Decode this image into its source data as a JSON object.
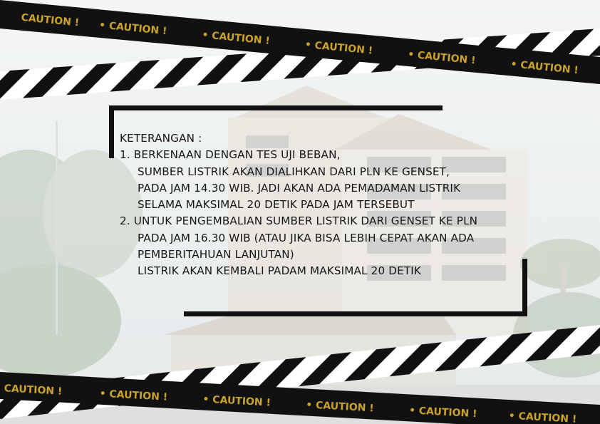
{
  "tape": {
    "label": "CAUTION !",
    "colors": {
      "tape": "#111111",
      "text": "#c9a227",
      "stripe": "#ffffff"
    }
  },
  "notice": {
    "heading": "KETERANGAN :",
    "item1": {
      "number": "1.",
      "line1": "BERKENAAN DENGAN TES UJI BEBAN,",
      "line2": "SUMBER LISTRIK AKAN DIALIHKAN DARI PLN KE GENSET,",
      "line3": "PADA JAM 14.30 WIB. JADI AKAN ADA PEMADAMAN LISTRIK",
      "line4": "SELAMA MAKSIMAL 20 DETIK PADA JAM TERSEBUT"
    },
    "item2": {
      "number": "2.",
      "line1": "UNTUK PENGEMBALIAN SUMBER LISTRIK DARI GENSET KE PLN",
      "line2": "PADA JAM 16.30 WIB (ATAU JIKA BISA LEBIH CEPAT AKAN ADA",
      "line3": "PEMBERITAHUAN LANJUTAN)",
      "line4": "LISTRIK AKAN KEMBALI PADAM MAKSIMAL 20 DETIK"
    }
  }
}
